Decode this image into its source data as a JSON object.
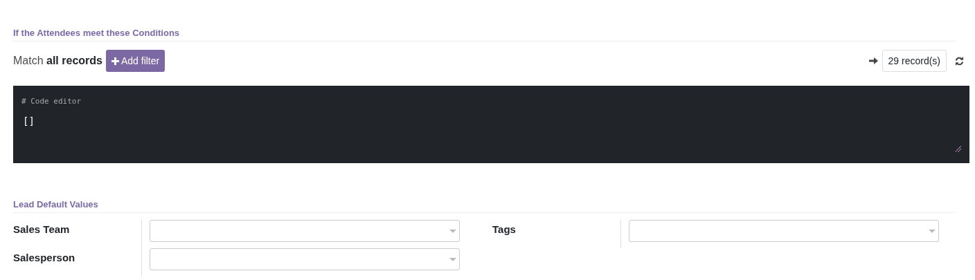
{
  "conditions": {
    "title": "If the Attendees meet these Conditions",
    "match_text": "Match **all records**",
    "add_filter": "Add filter",
    "record_count": "29 record(s)",
    "code_comment": "# Code editor",
    "code_value": "[]"
  },
  "defaults": {
    "title": "Lead Default Values",
    "columns": [
      {
        "fields": [
          {
            "label": "Sales Team"
          },
          {
            "label": "Salesperson"
          }
        ]
      },
      {
        "fields": [
          {
            "label": "Tags"
          }
        ]
      }
    ]
  }
}
